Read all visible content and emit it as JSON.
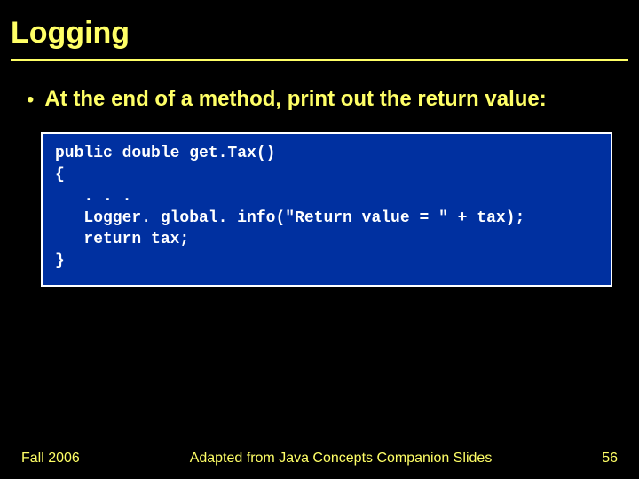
{
  "title": "Logging",
  "bullet": {
    "text": "At the end of a method, print out the return value:"
  },
  "code": "public double get.Tax()\n{\n   . . .\n   Logger. global. info(\"Return value = \" + tax);\n   return tax;\n}",
  "footer": {
    "left": "Fall 2006",
    "center": "Adapted from Java Concepts Companion Slides",
    "page": "56"
  }
}
